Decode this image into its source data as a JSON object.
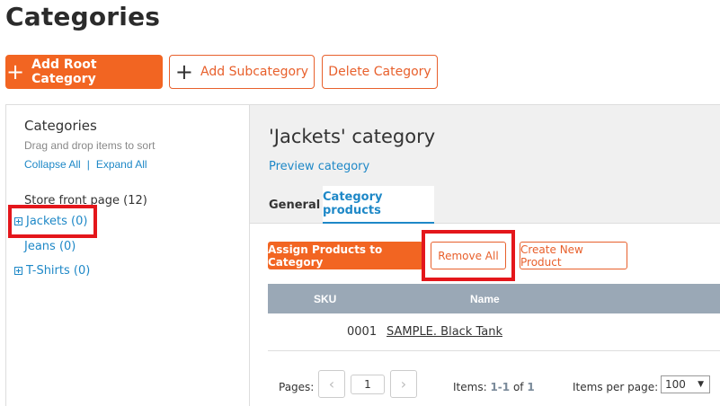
{
  "page": {
    "title": "Categories"
  },
  "toolbar": {
    "add_root": "Add Root Category",
    "add_sub": "Add Subcategory",
    "delete": "Delete Category"
  },
  "left": {
    "heading": "Categories",
    "hint": "Drag and drop items to sort",
    "collapse_all": "Collapse All",
    "separator": "|",
    "expand_all": "Expand All",
    "tree": {
      "root": "Store front page (12)",
      "jackets": "Jackets (0)",
      "jeans": "Jeans (0)",
      "tshirts": "T-Shirts (0)"
    }
  },
  "right": {
    "title": "'Jackets' category",
    "preview": "Preview category",
    "tabs": {
      "general": "General",
      "products": "Category products"
    },
    "actions": {
      "assign": "Assign Products to Category",
      "remove_all": "Remove All",
      "create_new": "Create New Product"
    },
    "table": {
      "headers": {
        "sku": "SKU",
        "name": "Name"
      },
      "rows": [
        {
          "sku": "0001",
          "name": "SAMPLE. Black Tank"
        }
      ]
    },
    "pager": {
      "pages_label": "Pages:",
      "prev": "‹",
      "current_page": "1",
      "next": "›",
      "items_label": "Items:",
      "items_range": "1-1",
      "items_of": "of",
      "items_total": "1",
      "per_page_label": "Items per page:",
      "per_page_value": "100",
      "select_arrow": "▼"
    }
  },
  "colors": {
    "accent": "#f26522",
    "link": "#1e88c7",
    "highlight": "#e4161b",
    "table_header": "#9aa8b6"
  },
  "icons": {
    "plus": "plus-icon",
    "expand": "expand-tree-icon"
  }
}
